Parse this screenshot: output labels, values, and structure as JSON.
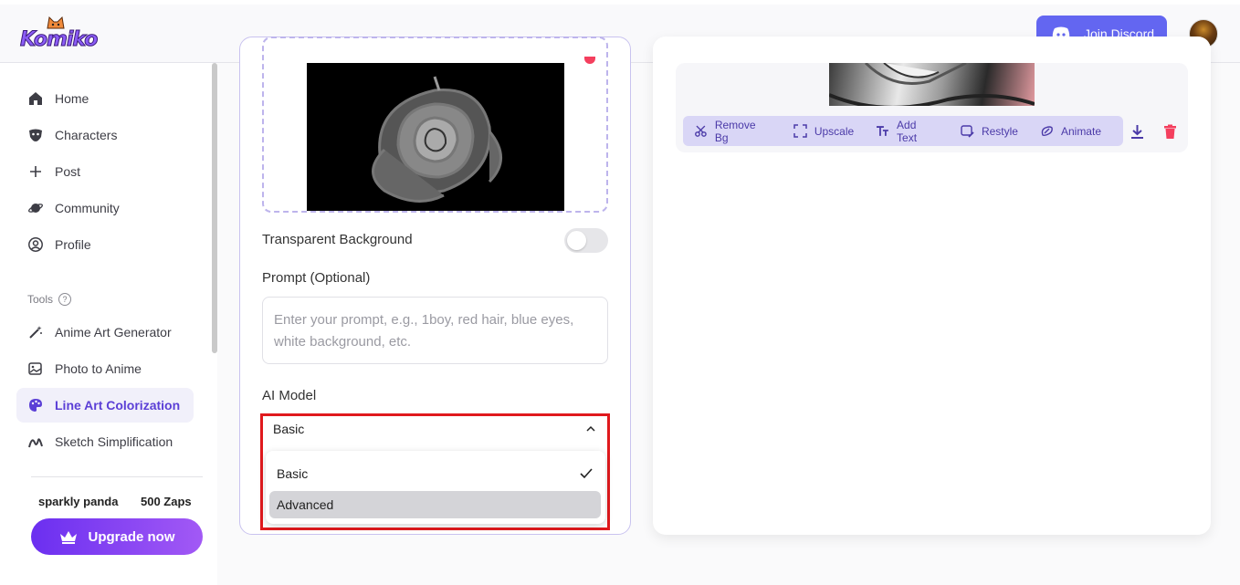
{
  "header": {
    "logo_text": "Komiko",
    "discord_label": "Join Discord"
  },
  "sidebar": {
    "nav": [
      {
        "label": "Home",
        "icon": "home-icon"
      },
      {
        "label": "Characters",
        "icon": "mask-icon"
      },
      {
        "label": "Post",
        "icon": "plus-icon"
      },
      {
        "label": "Community",
        "icon": "planet-icon"
      },
      {
        "label": "Profile",
        "icon": "user-circle-icon"
      }
    ],
    "tools_label": "Tools",
    "tools_help": "?",
    "tools": [
      {
        "label": "Anime Art Generator",
        "icon": "magic-wand-icon"
      },
      {
        "label": "Photo to Anime",
        "icon": "photo-icon"
      },
      {
        "label": "Line Art Colorization",
        "icon": "palette-icon",
        "active": true
      },
      {
        "label": "Sketch Simplification",
        "icon": "sketch-icon"
      }
    ],
    "user_name": "sparkly panda",
    "zaps": "500 Zaps",
    "upgrade_label": "Upgrade now"
  },
  "form": {
    "transparent_bg_label": "Transparent Background",
    "transparent_bg_on": false,
    "prompt_label": "Prompt (Optional)",
    "prompt_placeholder": "Enter your prompt, e.g., 1boy, red hair, blue eyes, white background, etc.",
    "model_label": "AI Model",
    "model_selected": "Basic",
    "model_options": [
      {
        "label": "Basic",
        "selected": true
      },
      {
        "label": "Advanced",
        "hovered": true
      }
    ]
  },
  "result": {
    "tools": [
      {
        "label": "Remove Bg",
        "icon": "scissors-icon"
      },
      {
        "label": "Upscale",
        "icon": "expand-icon"
      },
      {
        "label": "Add Text",
        "icon": "text-icon"
      },
      {
        "label": "Restyle",
        "icon": "restyle-icon"
      },
      {
        "label": "Animate",
        "icon": "animate-icon"
      }
    ]
  },
  "colors": {
    "accent": "#6366f1",
    "active_nav": "#5b3fd6",
    "delete": "#f43f5e",
    "highlight": "#e0191d"
  }
}
